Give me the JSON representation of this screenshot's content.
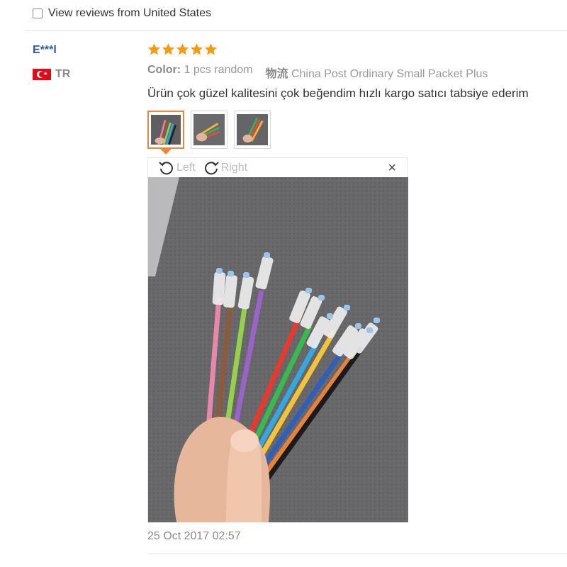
{
  "filter": {
    "label": "View reviews from United States",
    "checked": false
  },
  "review": {
    "user_name": "E***l",
    "country_code": "TR",
    "rating": 5,
    "color_label": "Color:",
    "color_value": "1 pcs random",
    "shipping_label": "物流",
    "shipping_value": "China Post Ordinary Small Packet Plus",
    "text": "Ürün çok güzel kalitesini çok beğendim hızlı kargo satıcı tabsiye ederim",
    "date": "25 Oct 2017 02:57"
  },
  "viewer": {
    "rotate_left_label": "Left",
    "rotate_right_label": "Right",
    "close_glyph": "×"
  },
  "colors": {
    "accent": "#e8883a",
    "star": "#f39c12",
    "user_link": "#2b5aa8"
  }
}
